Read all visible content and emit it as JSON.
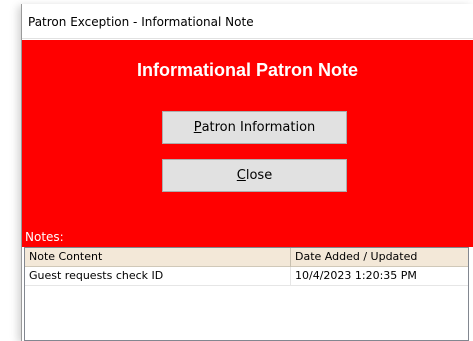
{
  "window": {
    "title": "Patron Exception - Informational Note"
  },
  "banner": {
    "title": "Informational Patron Note",
    "background": "#ff0000"
  },
  "buttons": {
    "patron_information": {
      "mnemonic": "P",
      "rest": "atron Information"
    },
    "close": {
      "mnemonic": "C",
      "rest": "lose"
    }
  },
  "notes": {
    "label": "Notes:",
    "columns": [
      "Note Content",
      "Date Added / Updated"
    ],
    "rows": [
      [
        "Guest requests check ID",
        "10/4/2023 1:20:35 PM"
      ]
    ]
  }
}
